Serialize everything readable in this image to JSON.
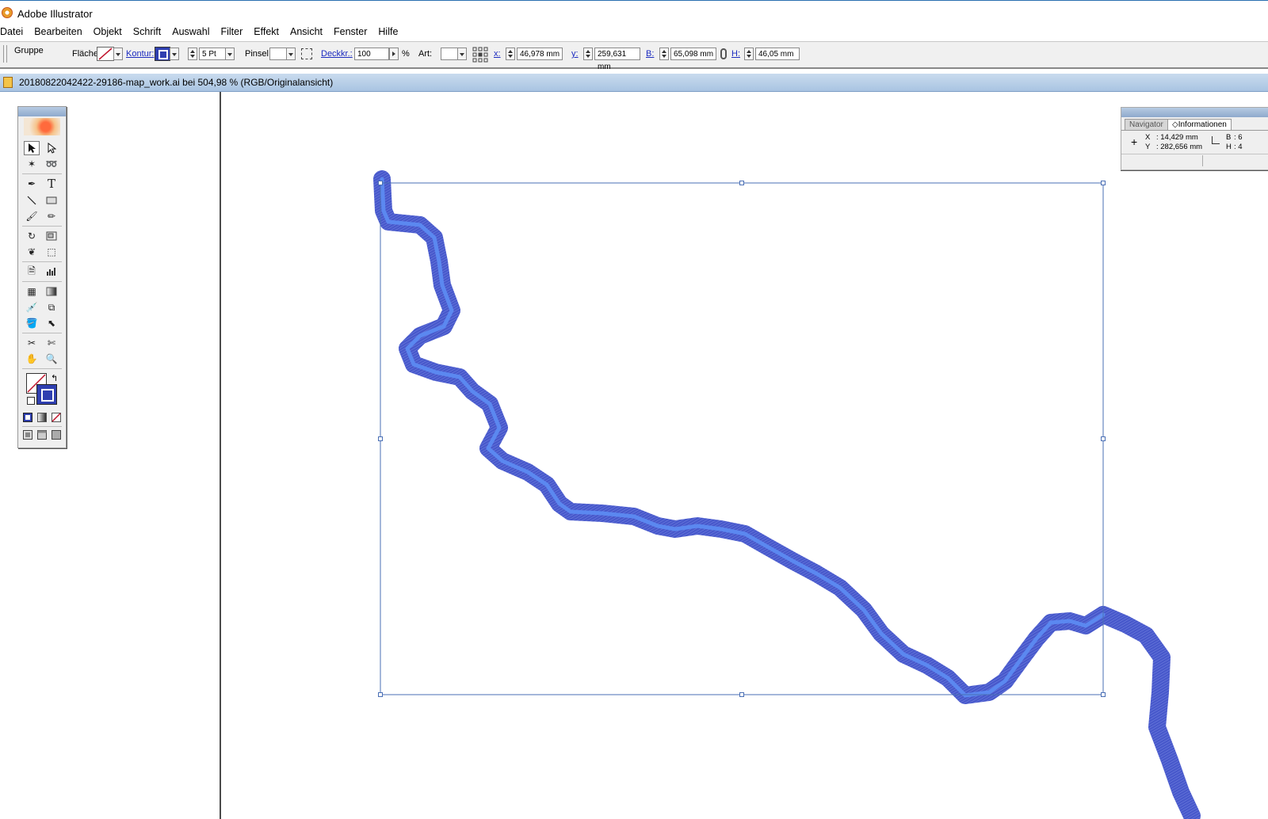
{
  "window": {
    "title": "Adobe Illustrator"
  },
  "menu": [
    "Datei",
    "Bearbeiten",
    "Objekt",
    "Schrift",
    "Auswahl",
    "Filter",
    "Effekt",
    "Ansicht",
    "Fenster",
    "Hilfe"
  ],
  "control": {
    "selection_type": "Gruppe",
    "fill_label": "Fläche:",
    "stroke_label": "Kontur:",
    "stroke_weight": "5 Pt",
    "brush_label": "Pinsel:",
    "opacity_label": "Deckkr.:",
    "opacity_value": "100",
    "opacity_unit": "%",
    "style_label": "Art:",
    "x_label": "x:",
    "x_value": "46,978 mm",
    "y_label": "y:",
    "y_value": "259,631 mm",
    "w_label": "B:",
    "w_value": "65,098 mm",
    "h_label": "H:",
    "h_value": "46,05 mm"
  },
  "document": {
    "tab_title": "20180822042422-29186-map_work.ai bei 504,98 % (RGB/Originalansicht)"
  },
  "tools": {
    "type_tool_glyph": "T"
  },
  "info_panel": {
    "tabs": [
      "Navigator",
      "Informationen"
    ],
    "x_label": "X",
    "x_value": ": 14,429 mm",
    "y_label": "Y",
    "y_value": ": 282,656 mm",
    "b_label": "B",
    "b_value": ": 6",
    "h_label": "H",
    "h_value": ": 4"
  },
  "colors": {
    "path_outer": "#3d4fc8",
    "path_inner": "#5b88f0",
    "selection": "#4a6fb5"
  }
}
